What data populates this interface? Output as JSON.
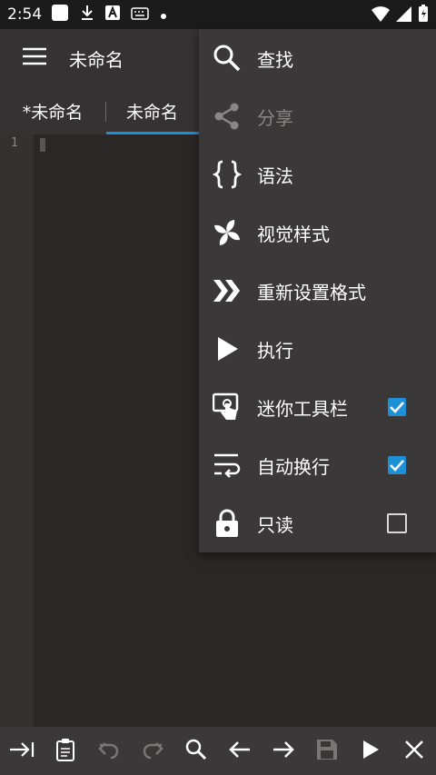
{
  "status_bar": {
    "time": "2:54"
  },
  "app_bar": {
    "title": "未命名"
  },
  "tabs": [
    {
      "label": "*未命名"
    },
    {
      "label": "未命名"
    }
  ],
  "editor": {
    "line_numbers": [
      "1"
    ]
  },
  "overflow_menu": {
    "items": [
      {
        "label": "查找",
        "icon": "search-icon"
      },
      {
        "label": "分享",
        "icon": "share-icon",
        "disabled": true
      },
      {
        "label": "语法",
        "icon": "braces-icon"
      },
      {
        "label": "视觉样式",
        "icon": "pinwheel-icon"
      },
      {
        "label": "重新设置格式",
        "icon": "double-chevron-icon"
      },
      {
        "label": "执行",
        "icon": "play-icon"
      },
      {
        "label": "迷你工具栏",
        "icon": "touch-icon",
        "checked": true
      },
      {
        "label": "自动换行",
        "icon": "wrap-icon",
        "checked": true
      },
      {
        "label": "只读",
        "icon": "lock-icon",
        "checked": false
      }
    ]
  },
  "colors": {
    "accent": "#1e90d6",
    "background": "#2b2727",
    "menu": "#3a3838"
  }
}
